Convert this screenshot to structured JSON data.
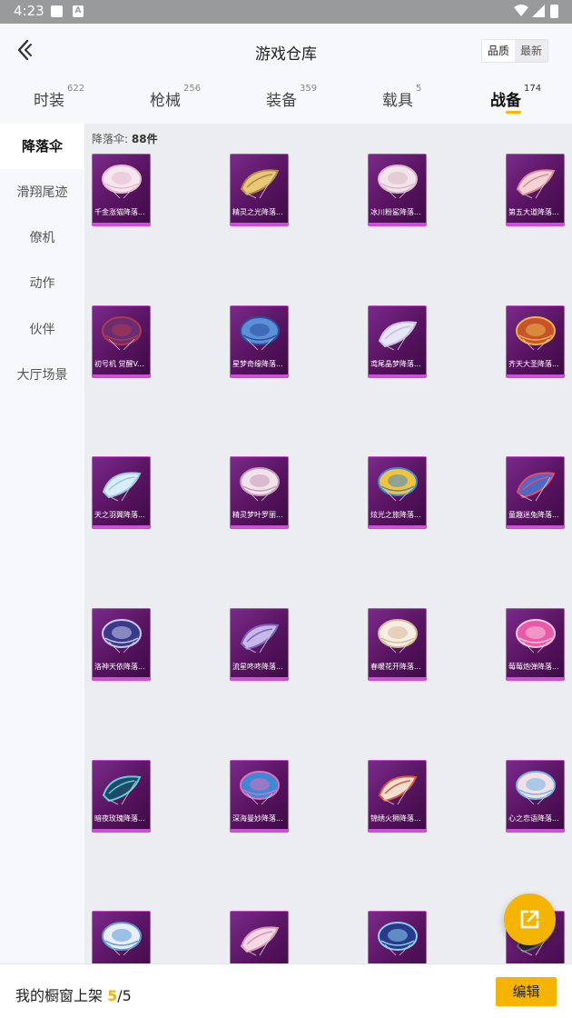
{
  "status": {
    "time": "4:23",
    "icon_a": "A"
  },
  "header": {
    "title": "游戏仓库",
    "back_icon": "chevron-left-icon"
  },
  "sort": {
    "options": [
      "品质",
      "最新"
    ],
    "selected": "品质"
  },
  "tabs": [
    {
      "label": "时装",
      "count": "622"
    },
    {
      "label": "枪械",
      "count": "256"
    },
    {
      "label": "装备",
      "count": "359"
    },
    {
      "label": "载具",
      "count": "5"
    },
    {
      "label": "战备",
      "count": "174",
      "active": true
    }
  ],
  "sidebar": [
    {
      "label": "降落伞",
      "active": true
    },
    {
      "label": "滑翔尾迹"
    },
    {
      "label": "僚机"
    },
    {
      "label": "动作"
    },
    {
      "label": "伙伴"
    },
    {
      "label": "大厅场景"
    }
  ],
  "content": {
    "count_label": "降落伞:",
    "count_value": "88件"
  },
  "items": [
    {
      "label": "千金涨猫降落...",
      "colors": [
        "#f6e6ee",
        "#e8b9cf"
      ]
    },
    {
      "label": "精灵之光降落...",
      "colors": [
        "#e8c878",
        "#b08a3c"
      ]
    },
    {
      "label": "冰川粉鲨降落...",
      "colors": [
        "#f2e4ea",
        "#d9b8c6"
      ]
    },
    {
      "label": "第五大道降落...",
      "colors": [
        "#f4d4d8",
        "#d98c98"
      ]
    },
    {
      "label": "初号机 觉醒V...",
      "colors": [
        "#6a2c72",
        "#b13a4a"
      ]
    },
    {
      "label": "星梦奇缘降落...",
      "colors": [
        "#5b8fd8",
        "#2b4e9a"
      ]
    },
    {
      "label": "鸢尾晶梦降落...",
      "colors": [
        "#e8e6f4",
        "#c3c0e0"
      ]
    },
    {
      "label": "齐天大圣降落...",
      "colors": [
        "#c8522a",
        "#e8b64a"
      ]
    },
    {
      "label": "天之羽翼降落...",
      "colors": [
        "#d8eef6",
        "#9cc8dc"
      ]
    },
    {
      "label": "精灵梦叶罗丽...",
      "colors": [
        "#f0e4ec",
        "#c898b8"
      ]
    },
    {
      "label": "炫光之旅降落...",
      "colors": [
        "#f2c43c",
        "#3a8ad8"
      ]
    },
    {
      "label": "童趣迷兔降落...",
      "colors": [
        "#4a6ac8",
        "#e84a6a"
      ]
    },
    {
      "label": "洛神天依降落...",
      "colors": [
        "#3a3a8a",
        "#c8c8f0"
      ]
    },
    {
      "label": "流星咚咚降落...",
      "colors": [
        "#c8b8e8",
        "#7a68c0"
      ]
    },
    {
      "label": "春暖花开降落...",
      "colors": [
        "#f4eee4",
        "#d8b898"
      ]
    },
    {
      "label": "莓莓炮弹降落...",
      "colors": [
        "#e85aa8",
        "#f4c8e0"
      ]
    },
    {
      "label": "暗夜玫瑰降落...",
      "colors": [
        "#1e4a6a",
        "#5ad0d8"
      ]
    },
    {
      "label": "深海曼妙降落...",
      "colors": [
        "#3a8ad8",
        "#e86ab8"
      ]
    },
    {
      "label": "锦绣火狮降落...",
      "colors": [
        "#f0e0d4",
        "#d8583a"
      ]
    },
    {
      "label": "心之恋语降落...",
      "colors": [
        "#f4e0e4",
        "#6ab8e8"
      ]
    },
    {
      "label": "",
      "colors": [
        "#e8eef8",
        "#5a9ad8"
      ]
    },
    {
      "label": "",
      "colors": [
        "#f4d8e4",
        "#d898b8"
      ]
    },
    {
      "label": "",
      "colors": [
        "#2a3a8a",
        "#8ad0f0"
      ]
    },
    {
      "label": "",
      "colors": [
        "#2a2a3a",
        "#6a6a7a"
      ]
    }
  ],
  "bottom": {
    "showcase_label": "我的橱窗上架",
    "showcase_current": "5",
    "showcase_sep": "/",
    "showcase_total": "5",
    "edit_label": "编辑"
  },
  "fab": {
    "icon": "share-external-icon"
  },
  "accent_color": "#f5b400"
}
